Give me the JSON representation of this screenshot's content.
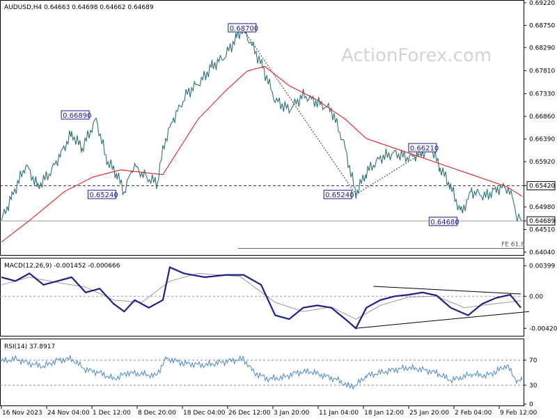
{
  "chart_data": [
    {
      "type": "line",
      "pane": "price",
      "header": "AUDUSD,H4  0.64663 0.64698 0.64662 0.64689",
      "watermark": "ActionForex.com",
      "x_ticks": [
        "16 Nov 2023",
        "24 Nov 04:00",
        "1 Dec 12:00",
        "8 Dec 20:00",
        "18 Dec 04:00",
        "26 Dec 12:00",
        "3 Jan 20:00",
        "11 Jan 04:00",
        "18 Jan 12:00",
        "25 Jan 20:00",
        "2 Feb 04:00",
        "9 Feb 12:00"
      ],
      "y_ticks": [
        "0.69220",
        "0.68750",
        "0.68290",
        "0.67810",
        "0.67330",
        "0.66860",
        "0.66390",
        "0.65920",
        "0.65420",
        "0.64980",
        "0.64689",
        "0.64510",
        "0.64040"
      ],
      "ylim": [
        0.6404,
        0.6922
      ],
      "price_path": [
        [
          0,
          0.647
        ],
        [
          15,
          0.652
        ],
        [
          35,
          0.6585
        ],
        [
          52,
          0.654
        ],
        [
          70,
          0.657
        ],
        [
          85,
          0.661
        ],
        [
          100,
          0.665
        ],
        [
          115,
          0.662
        ],
        [
          135,
          0.668
        ],
        [
          150,
          0.6595
        ],
        [
          165,
          0.6565
        ],
        [
          175,
          0.6528
        ],
        [
          188,
          0.6585
        ],
        [
          205,
          0.656
        ],
        [
          222,
          0.6548
        ],
        [
          232,
          0.663
        ],
        [
          245,
          0.668
        ],
        [
          265,
          0.6735
        ],
        [
          285,
          0.676
        ],
        [
          300,
          0.679
        ],
        [
          318,
          0.681
        ],
        [
          335,
          0.685
        ],
        [
          343,
          0.6868
        ],
        [
          355,
          0.684
        ],
        [
          372,
          0.679
        ],
        [
          390,
          0.672
        ],
        [
          410,
          0.67
        ],
        [
          430,
          0.673
        ],
        [
          450,
          0.6715
        ],
        [
          470,
          0.67
        ],
        [
          488,
          0.663
        ],
        [
          505,
          0.6525
        ],
        [
          520,
          0.657
        ],
        [
          540,
          0.66
        ],
        [
          560,
          0.661
        ],
        [
          580,
          0.66
        ],
        [
          600,
          0.661
        ],
        [
          612,
          0.6621
        ],
        [
          625,
          0.658
        ],
        [
          640,
          0.654
        ],
        [
          655,
          0.6485
        ],
        [
          670,
          0.653
        ],
        [
          690,
          0.652
        ],
        [
          705,
          0.6535
        ],
        [
          720,
          0.654
        ],
        [
          730,
          0.651
        ],
        [
          735,
          0.6475
        ],
        [
          742,
          0.6469
        ]
      ],
      "ma_path": [
        [
          0,
          0.6425
        ],
        [
          40,
          0.647
        ],
        [
          90,
          0.653
        ],
        [
          130,
          0.656
        ],
        [
          170,
          0.6575
        ],
        [
          230,
          0.6565
        ],
        [
          280,
          0.668
        ],
        [
          320,
          0.674
        ],
        [
          350,
          0.678
        ],
        [
          375,
          0.679
        ],
        [
          410,
          0.675
        ],
        [
          450,
          0.672
        ],
        [
          490,
          0.668
        ],
        [
          520,
          0.664
        ],
        [
          560,
          0.662
        ],
        [
          600,
          0.66
        ],
        [
          640,
          0.658
        ],
        [
          680,
          0.656
        ],
        [
          720,
          0.654
        ],
        [
          742,
          0.652
        ]
      ],
      "levels": [
        {
          "value": 0.6542,
          "style": "dashed",
          "tag": "0.65420"
        },
        {
          "value": 0.64689,
          "style": "solid",
          "tag": "0.64689"
        }
      ],
      "annotations": [
        {
          "text": "0.68700",
          "x": 343,
          "y": 0.687
        },
        {
          "text": "0.66890",
          "x": 135,
          "y": 0.6689
        },
        {
          "text": "0.65240",
          "x": 173,
          "y": 0.6524
        },
        {
          "text": "0.65240",
          "x": 505,
          "y": 0.6524
        },
        {
          "text": "0.66210",
          "x": 612,
          "y": 0.6621
        },
        {
          "text": "0.64680",
          "x": 655,
          "y": 0.6468
        }
      ],
      "fe_label": "FE 61.8",
      "fe_level": 0.6412,
      "colors": {
        "price": "#2e6f78",
        "ma": "#e02020",
        "levels": "#444444",
        "labels": "#1a1a8c"
      }
    },
    {
      "type": "line",
      "pane": "macd",
      "header": "MACD(12,26,9) -0.001452 -0.000666",
      "y_ticks": [
        "0.00399",
        "0.00",
        "-0.004206"
      ],
      "ylim": [
        -0.005,
        0.0045
      ],
      "macd_path": [
        [
          0,
          0.0025
        ],
        [
          20,
          0.002
        ],
        [
          40,
          0.003
        ],
        [
          60,
          0.0015
        ],
        [
          80,
          0.002
        ],
        [
          100,
          0.0025
        ],
        [
          120,
          0.0005
        ],
        [
          140,
          0.001
        ],
        [
          160,
          -0.001
        ],
        [
          175,
          -0.002
        ],
        [
          190,
          -0.0005
        ],
        [
          210,
          -0.0015
        ],
        [
          230,
          -0.0005
        ],
        [
          240,
          0.0038
        ],
        [
          260,
          0.003
        ],
        [
          290,
          0.0025
        ],
        [
          320,
          0.0028
        ],
        [
          345,
          0.0028
        ],
        [
          370,
          0.0015
        ],
        [
          390,
          -0.0025
        ],
        [
          410,
          -0.003
        ],
        [
          430,
          -0.0015
        ],
        [
          450,
          -0.0012
        ],
        [
          470,
          -0.0015
        ],
        [
          490,
          -0.003
        ],
        [
          505,
          -0.0042
        ],
        [
          520,
          -0.0015
        ],
        [
          540,
          -0.0005
        ],
        [
          560,
          0.0
        ],
        [
          580,
          0.0002
        ],
        [
          600,
          0.0005
        ],
        [
          620,
          0.0001
        ],
        [
          640,
          -0.0015
        ],
        [
          665,
          -0.0025
        ],
        [
          685,
          -0.001
        ],
        [
          705,
          -0.0002
        ],
        [
          725,
          0.0002
        ],
        [
          740,
          -0.0015
        ]
      ],
      "signal_path": [
        [
          0,
          0.0015
        ],
        [
          40,
          0.0025
        ],
        [
          80,
          0.0018
        ],
        [
          120,
          0.0012
        ],
        [
          160,
          -0.0005
        ],
        [
          200,
          -0.0008
        ],
        [
          240,
          0.002
        ],
        [
          280,
          0.003
        ],
        [
          340,
          0.0026
        ],
        [
          390,
          -0.0008
        ],
        [
          430,
          -0.002
        ],
        [
          470,
          -0.0014
        ],
        [
          505,
          -0.003
        ],
        [
          540,
          -0.0012
        ],
        [
          580,
          -0.0001
        ],
        [
          620,
          0.0
        ],
        [
          660,
          -0.0015
        ],
        [
          700,
          -0.001
        ],
        [
          740,
          -0.0006
        ]
      ],
      "trendlines": [
        [
          [
            530,
            0.0013
          ],
          [
            740,
            0.0003
          ]
        ],
        [
          [
            505,
            -0.0042
          ],
          [
            752,
            -0.002
          ]
        ]
      ],
      "colors": {
        "macd": "#1f1f8a",
        "signal": "#9a9a9a"
      }
    },
    {
      "type": "line",
      "pane": "rsi",
      "header": "RSI(14) 37.8917",
      "y_ticks": [
        "70",
        "30",
        "0"
      ],
      "ylim": [
        0,
        100
      ],
      "rsi_path": [
        [
          0,
          68
        ],
        [
          20,
          72
        ],
        [
          40,
          65
        ],
        [
          60,
          60
        ],
        [
          80,
          70
        ],
        [
          100,
          72
        ],
        [
          120,
          55
        ],
        [
          140,
          50
        ],
        [
          160,
          40
        ],
        [
          180,
          50
        ],
        [
          200,
          48
        ],
        [
          220,
          45
        ],
        [
          235,
          73
        ],
        [
          260,
          65
        ],
        [
          290,
          62
        ],
        [
          320,
          68
        ],
        [
          345,
          72
        ],
        [
          360,
          50
        ],
        [
          380,
          40
        ],
        [
          400,
          42
        ],
        [
          420,
          50
        ],
        [
          440,
          52
        ],
        [
          460,
          45
        ],
        [
          480,
          38
        ],
        [
          495,
          28
        ],
        [
          505,
          30
        ],
        [
          520,
          45
        ],
        [
          540,
          50
        ],
        [
          560,
          55
        ],
        [
          580,
          58
        ],
        [
          600,
          55
        ],
        [
          620,
          50
        ],
        [
          640,
          38
        ],
        [
          655,
          42
        ],
        [
          670,
          48
        ],
        [
          690,
          45
        ],
        [
          705,
          52
        ],
        [
          720,
          62
        ],
        [
          735,
          36
        ],
        [
          742,
          38
        ]
      ],
      "colors": {
        "rsi": "#4a88c8",
        "levels": "#888888"
      }
    }
  ]
}
